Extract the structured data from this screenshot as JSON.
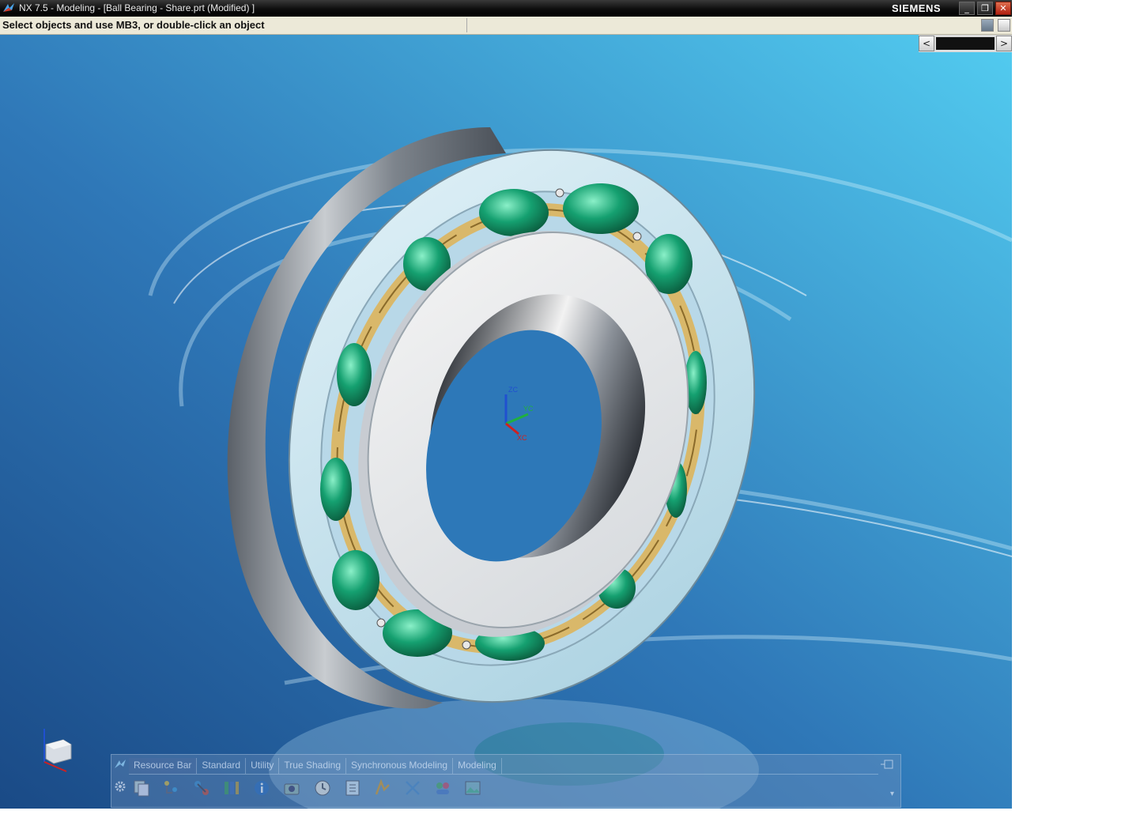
{
  "window": {
    "title": "NX 7.5 - Modeling - [Ball Bearing - Share.prt (Modified) ]",
    "brand": "SIEMENS",
    "minimize_label": "_",
    "restore_label": "❐",
    "close_label": "✕"
  },
  "cue_line": {
    "text": "Select objects and use MB3, or double-click an object"
  },
  "scrollbar": {
    "left_arrow": "<",
    "right_arrow": ">"
  },
  "viewport": {
    "wcs_labels": {
      "z": "ZC",
      "y": "YC",
      "x": "XC"
    },
    "colors": {
      "background_dark": "#1d4f8a",
      "background_light": "#4fc8ee",
      "ring_metal": "#d9dde2",
      "balls": "#15a070",
      "cage": "#d9b86a"
    }
  },
  "toolbar": {
    "tabs": [
      "Resource Bar",
      "Standard",
      "Utility",
      "True Shading",
      "Synchronous Modeling",
      "Modeling"
    ],
    "dropdown_glyph": "▾",
    "icons": [
      "copy-icon",
      "assembly-navigator-icon",
      "constraint-icon",
      "part-navigator-icon",
      "info-icon",
      "camera-icon",
      "history-icon",
      "reuse-library-icon",
      "analysis-icon",
      "transform-icon",
      "roles-icon",
      "image-icon"
    ]
  }
}
